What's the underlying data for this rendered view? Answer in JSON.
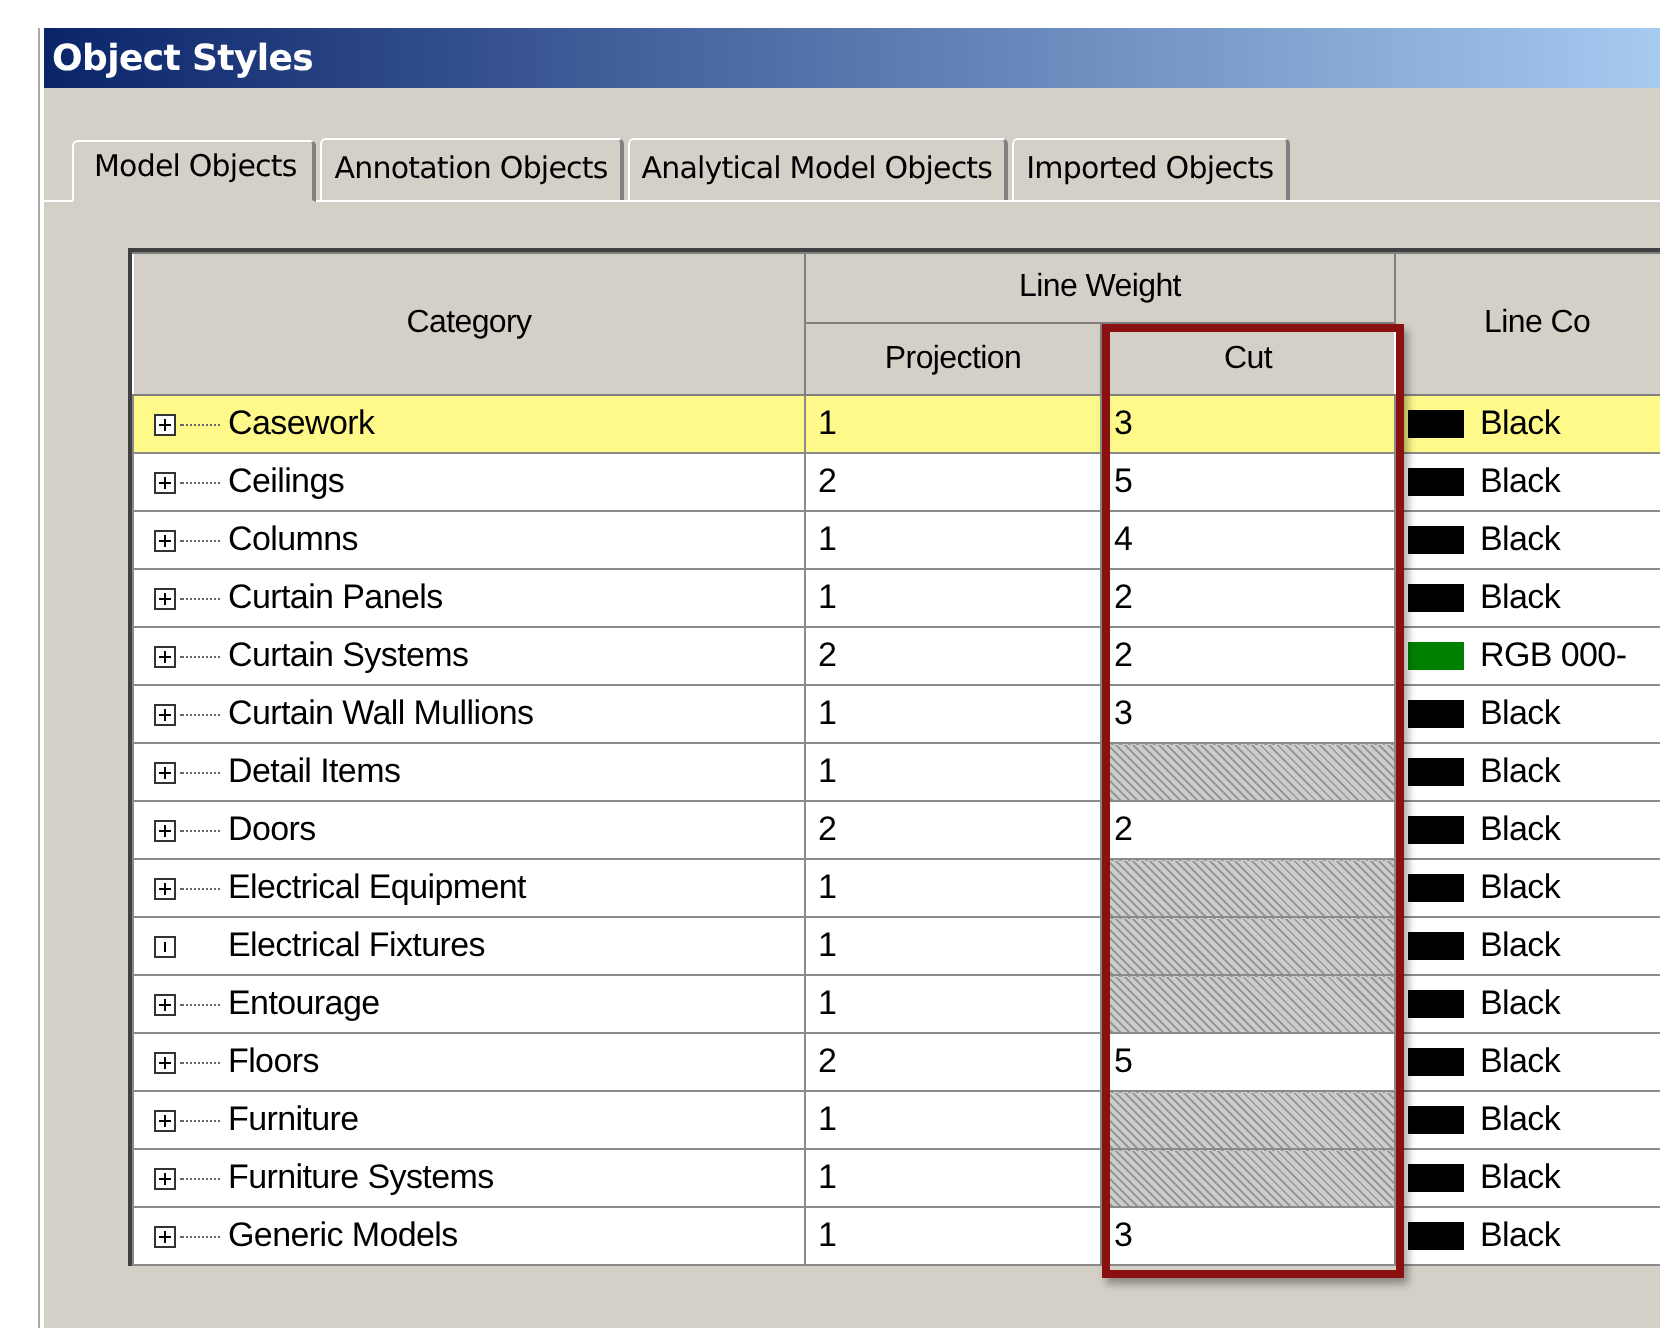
{
  "window": {
    "title": "Object Styles"
  },
  "tabs": [
    {
      "label": "Model Objects",
      "selected": true
    },
    {
      "label": "Annotation Objects",
      "selected": false
    },
    {
      "label": "Analytical Model Objects",
      "selected": false
    },
    {
      "label": "Imported Objects",
      "selected": false
    }
  ],
  "table": {
    "columns": {
      "category": "Category",
      "line_weight": "Line Weight",
      "projection": "Projection",
      "cut": "Cut",
      "line_color": "Line Co"
    },
    "cut_column_highlighted": true,
    "rows": [
      {
        "category": "Casework",
        "expandable": true,
        "selected": true,
        "projection": "1",
        "cut": "3",
        "cut_editable": true,
        "line_color": "Black",
        "color": "#000000"
      },
      {
        "category": "Ceilings",
        "expandable": true,
        "selected": false,
        "projection": "2",
        "cut": "5",
        "cut_editable": true,
        "line_color": "Black",
        "color": "#000000"
      },
      {
        "category": "Columns",
        "expandable": true,
        "selected": false,
        "projection": "1",
        "cut": "4",
        "cut_editable": true,
        "line_color": "Black",
        "color": "#000000"
      },
      {
        "category": "Curtain Panels",
        "expandable": true,
        "selected": false,
        "projection": "1",
        "cut": "2",
        "cut_editable": true,
        "line_color": "Black",
        "color": "#000000"
      },
      {
        "category": "Curtain Systems",
        "expandable": true,
        "selected": false,
        "projection": "2",
        "cut": "2",
        "cut_editable": true,
        "line_color": "RGB 000-",
        "color": "#008000"
      },
      {
        "category": "Curtain Wall Mullions",
        "expandable": true,
        "selected": false,
        "projection": "1",
        "cut": "3",
        "cut_editable": true,
        "line_color": "Black",
        "color": "#000000"
      },
      {
        "category": "Detail Items",
        "expandable": true,
        "selected": false,
        "projection": "1",
        "cut_editable": false,
        "line_color": "Black",
        "color": "#000000"
      },
      {
        "category": "Doors",
        "expandable": true,
        "selected": false,
        "projection": "2",
        "cut": "2",
        "cut_editable": true,
        "line_color": "Black",
        "color": "#000000"
      },
      {
        "category": "Electrical Equipment",
        "expandable": true,
        "selected": false,
        "projection": "1",
        "cut_editable": false,
        "line_color": "Black",
        "color": "#000000"
      },
      {
        "category": "Electrical Fixtures",
        "expandable": false,
        "selected": false,
        "projection": "1",
        "cut_editable": false,
        "line_color": "Black",
        "color": "#000000"
      },
      {
        "category": "Entourage",
        "expandable": true,
        "selected": false,
        "projection": "1",
        "cut_editable": false,
        "line_color": "Black",
        "color": "#000000"
      },
      {
        "category": "Floors",
        "expandable": true,
        "selected": false,
        "projection": "2",
        "cut": "5",
        "cut_editable": true,
        "line_color": "Black",
        "color": "#000000"
      },
      {
        "category": "Furniture",
        "expandable": true,
        "selected": false,
        "projection": "1",
        "cut_editable": false,
        "line_color": "Black",
        "color": "#000000"
      },
      {
        "category": "Furniture Systems",
        "expandable": true,
        "selected": false,
        "projection": "1",
        "cut_editable": false,
        "line_color": "Black",
        "color": "#000000"
      },
      {
        "category": "Generic Models",
        "expandable": true,
        "selected": false,
        "projection": "1",
        "cut": "3",
        "cut_editable": true,
        "line_color": "Black",
        "color": "#000000"
      }
    ]
  }
}
